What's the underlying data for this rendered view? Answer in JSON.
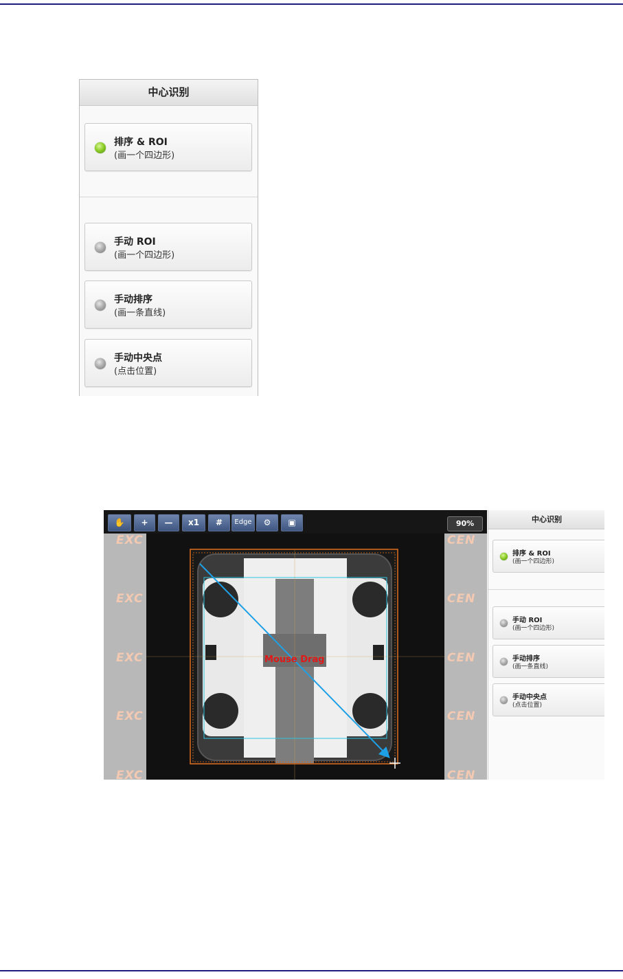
{
  "panel": {
    "title": "中心识别",
    "items": [
      {
        "label": "排序 & ROI",
        "hint": "(画一个四边形)",
        "status": "active"
      },
      {
        "label": "手动 ROI",
        "hint": "(画一个四边形)",
        "status": "inactive"
      },
      {
        "label": "手动排序",
        "hint": "(画一条直线)",
        "status": "inactive"
      },
      {
        "label": "手动中央点",
        "hint": "(点击位置)",
        "status": "inactive"
      }
    ]
  },
  "viewer": {
    "toolbar": {
      "pan_icon": "hand-icon",
      "zoom_in_label": "+",
      "zoom_out_label": "—",
      "reset_zoom_label": "x1",
      "grid_label": "#",
      "edge_label": "Edge",
      "settings_icon": "gear-icon",
      "save_icon": "floppy-disk-icon",
      "zoom_level": "90%"
    },
    "watermark_left": "EXC",
    "watermark_right": "CEN",
    "annotation": "Mouse Drag"
  },
  "colors": {
    "accent_button": "#4a6491",
    "status_active": "#8fcf2a",
    "status_inactive": "#a9a9a9",
    "annotation_text": "#e01818",
    "drag_arrow": "#1ea0e6",
    "roi_box": "#e07020",
    "rule_line": "#1b1b7a"
  }
}
